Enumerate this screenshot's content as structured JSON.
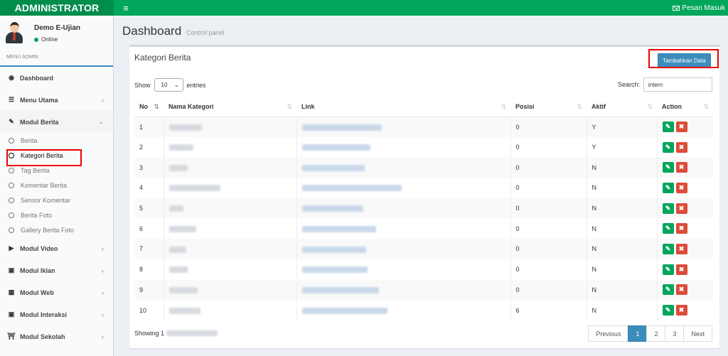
{
  "topbar": {
    "brand": "ADMINISTRATOR",
    "menu_toggle": "≡",
    "messages_label": "Pesan Masuk"
  },
  "user": {
    "name": "Demo E-Ujian",
    "status": "Online"
  },
  "sidebar": {
    "header": "MENU ADMIN",
    "items": [
      {
        "label": "Dashboard",
        "icon": "dashboard-icon"
      },
      {
        "label": "Menu Utama",
        "icon": "list-icon"
      },
      {
        "label": "Modul Berita",
        "icon": "pencil-icon"
      },
      {
        "label": "Modul Video",
        "icon": "play-icon"
      },
      {
        "label": "Modul Iklan",
        "icon": "tv-icon"
      },
      {
        "label": "Modul Web",
        "icon": "building-icon"
      },
      {
        "label": "Modul Interaksi",
        "icon": "tv-icon"
      },
      {
        "label": "Modul Sekolah",
        "icon": "bank-icon"
      }
    ],
    "berita_sub": [
      "Berita",
      "Kategori Berita",
      "Tag Berita",
      "Komentar Berita",
      "Sensor Komentar",
      "Berita Foto",
      "Gallery Berita Foto"
    ]
  },
  "content": {
    "title": "Dashboard",
    "subtitle": "Control panel"
  },
  "box": {
    "title": "Kategori Berita",
    "add_button": "Tambahkan Data",
    "show": "Show",
    "entries_value": "10",
    "entries": "entries",
    "search_label": "Search:",
    "search_value": "intern",
    "showing": "Showing 1"
  },
  "table": {
    "columns": [
      "No",
      "Nama Kategori",
      "Link",
      "Posisi",
      "Aktif",
      "Action"
    ],
    "rows": [
      {
        "no": "1",
        "posisi": "0",
        "aktif": "Y"
      },
      {
        "no": "2",
        "posisi": "0",
        "aktif": "Y"
      },
      {
        "no": "3",
        "posisi": "0",
        "aktif": "N"
      },
      {
        "no": "4",
        "posisi": "0",
        "aktif": "N"
      },
      {
        "no": "5",
        "posisi": "0",
        "aktif": "N"
      },
      {
        "no": "6",
        "posisi": "0",
        "aktif": "N"
      },
      {
        "no": "7",
        "posisi": "0",
        "aktif": "N"
      },
      {
        "no": "8",
        "posisi": "0",
        "aktif": "N"
      },
      {
        "no": "9",
        "posisi": "0",
        "aktif": "N"
      },
      {
        "no": "10",
        "posisi": "6",
        "aktif": "N"
      }
    ]
  },
  "pagination": {
    "previous": "Previous",
    "pages": [
      "1",
      "2",
      "3"
    ],
    "next": "Next"
  },
  "colors": {
    "header_green": "#00a65a",
    "brand_green": "#008d4c",
    "primary_blue": "#3c8dbc",
    "danger_red": "#dd4b39"
  }
}
